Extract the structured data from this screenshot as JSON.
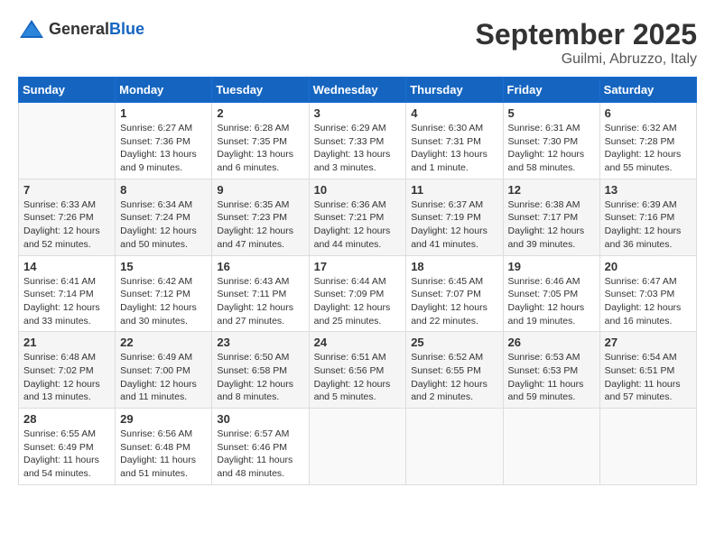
{
  "header": {
    "logo_general": "General",
    "logo_blue": "Blue",
    "month": "September 2025",
    "location": "Guilmi, Abruzzo, Italy"
  },
  "days_of_week": [
    "Sunday",
    "Monday",
    "Tuesday",
    "Wednesday",
    "Thursday",
    "Friday",
    "Saturday"
  ],
  "weeks": [
    [
      {
        "day": "",
        "info": ""
      },
      {
        "day": "1",
        "info": "Sunrise: 6:27 AM\nSunset: 7:36 PM\nDaylight: 13 hours\nand 9 minutes."
      },
      {
        "day": "2",
        "info": "Sunrise: 6:28 AM\nSunset: 7:35 PM\nDaylight: 13 hours\nand 6 minutes."
      },
      {
        "day": "3",
        "info": "Sunrise: 6:29 AM\nSunset: 7:33 PM\nDaylight: 13 hours\nand 3 minutes."
      },
      {
        "day": "4",
        "info": "Sunrise: 6:30 AM\nSunset: 7:31 PM\nDaylight: 13 hours\nand 1 minute."
      },
      {
        "day": "5",
        "info": "Sunrise: 6:31 AM\nSunset: 7:30 PM\nDaylight: 12 hours\nand 58 minutes."
      },
      {
        "day": "6",
        "info": "Sunrise: 6:32 AM\nSunset: 7:28 PM\nDaylight: 12 hours\nand 55 minutes."
      }
    ],
    [
      {
        "day": "7",
        "info": "Sunrise: 6:33 AM\nSunset: 7:26 PM\nDaylight: 12 hours\nand 52 minutes."
      },
      {
        "day": "8",
        "info": "Sunrise: 6:34 AM\nSunset: 7:24 PM\nDaylight: 12 hours\nand 50 minutes."
      },
      {
        "day": "9",
        "info": "Sunrise: 6:35 AM\nSunset: 7:23 PM\nDaylight: 12 hours\nand 47 minutes."
      },
      {
        "day": "10",
        "info": "Sunrise: 6:36 AM\nSunset: 7:21 PM\nDaylight: 12 hours\nand 44 minutes."
      },
      {
        "day": "11",
        "info": "Sunrise: 6:37 AM\nSunset: 7:19 PM\nDaylight: 12 hours\nand 41 minutes."
      },
      {
        "day": "12",
        "info": "Sunrise: 6:38 AM\nSunset: 7:17 PM\nDaylight: 12 hours\nand 39 minutes."
      },
      {
        "day": "13",
        "info": "Sunrise: 6:39 AM\nSunset: 7:16 PM\nDaylight: 12 hours\nand 36 minutes."
      }
    ],
    [
      {
        "day": "14",
        "info": "Sunrise: 6:41 AM\nSunset: 7:14 PM\nDaylight: 12 hours\nand 33 minutes."
      },
      {
        "day": "15",
        "info": "Sunrise: 6:42 AM\nSunset: 7:12 PM\nDaylight: 12 hours\nand 30 minutes."
      },
      {
        "day": "16",
        "info": "Sunrise: 6:43 AM\nSunset: 7:11 PM\nDaylight: 12 hours\nand 27 minutes."
      },
      {
        "day": "17",
        "info": "Sunrise: 6:44 AM\nSunset: 7:09 PM\nDaylight: 12 hours\nand 25 minutes."
      },
      {
        "day": "18",
        "info": "Sunrise: 6:45 AM\nSunset: 7:07 PM\nDaylight: 12 hours\nand 22 minutes."
      },
      {
        "day": "19",
        "info": "Sunrise: 6:46 AM\nSunset: 7:05 PM\nDaylight: 12 hours\nand 19 minutes."
      },
      {
        "day": "20",
        "info": "Sunrise: 6:47 AM\nSunset: 7:03 PM\nDaylight: 12 hours\nand 16 minutes."
      }
    ],
    [
      {
        "day": "21",
        "info": "Sunrise: 6:48 AM\nSunset: 7:02 PM\nDaylight: 12 hours\nand 13 minutes."
      },
      {
        "day": "22",
        "info": "Sunrise: 6:49 AM\nSunset: 7:00 PM\nDaylight: 12 hours\nand 11 minutes."
      },
      {
        "day": "23",
        "info": "Sunrise: 6:50 AM\nSunset: 6:58 PM\nDaylight: 12 hours\nand 8 minutes."
      },
      {
        "day": "24",
        "info": "Sunrise: 6:51 AM\nSunset: 6:56 PM\nDaylight: 12 hours\nand 5 minutes."
      },
      {
        "day": "25",
        "info": "Sunrise: 6:52 AM\nSunset: 6:55 PM\nDaylight: 12 hours\nand 2 minutes."
      },
      {
        "day": "26",
        "info": "Sunrise: 6:53 AM\nSunset: 6:53 PM\nDaylight: 11 hours\nand 59 minutes."
      },
      {
        "day": "27",
        "info": "Sunrise: 6:54 AM\nSunset: 6:51 PM\nDaylight: 11 hours\nand 57 minutes."
      }
    ],
    [
      {
        "day": "28",
        "info": "Sunrise: 6:55 AM\nSunset: 6:49 PM\nDaylight: 11 hours\nand 54 minutes."
      },
      {
        "day": "29",
        "info": "Sunrise: 6:56 AM\nSunset: 6:48 PM\nDaylight: 11 hours\nand 51 minutes."
      },
      {
        "day": "30",
        "info": "Sunrise: 6:57 AM\nSunset: 6:46 PM\nDaylight: 11 hours\nand 48 minutes."
      },
      {
        "day": "",
        "info": ""
      },
      {
        "day": "",
        "info": ""
      },
      {
        "day": "",
        "info": ""
      },
      {
        "day": "",
        "info": ""
      }
    ]
  ]
}
